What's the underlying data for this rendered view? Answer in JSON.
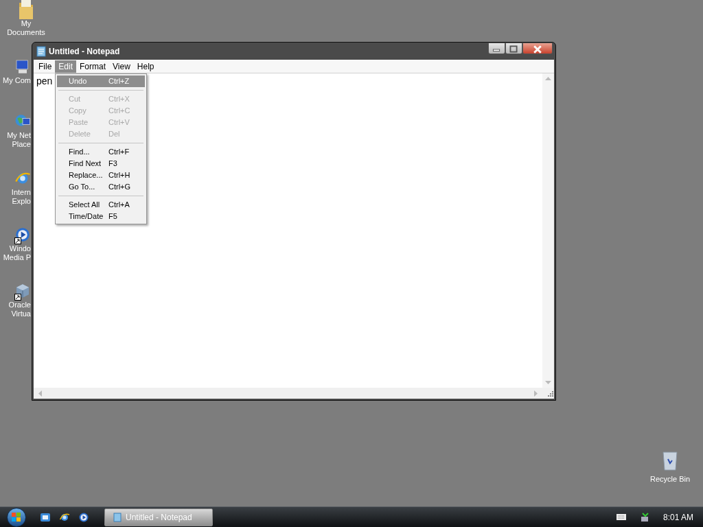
{
  "desktop_icons": [
    {
      "kind": "folder",
      "shortcut": false,
      "label_lines": [
        "My",
        "Documents"
      ]
    },
    {
      "kind": "computer",
      "shortcut": false,
      "label_lines": [
        "My Com"
      ]
    },
    {
      "kind": "network",
      "shortcut": false,
      "label_lines": [
        "My Net",
        "Place"
      ]
    },
    {
      "kind": "browser",
      "shortcut": false,
      "label_lines": [
        "Intern",
        "Explo"
      ]
    },
    {
      "kind": "media",
      "shortcut": true,
      "label_lines": [
        "Windo",
        "Media P"
      ]
    },
    {
      "kind": "cube",
      "shortcut": true,
      "label_lines": [
        "Oracle",
        "Virtua"
      ]
    }
  ],
  "window": {
    "title": "Untitled - Notepad",
    "menu": [
      {
        "label": "File",
        "selected": false
      },
      {
        "label": "Edit",
        "selected": true
      },
      {
        "label": "Format",
        "selected": false
      },
      {
        "label": "View",
        "selected": false
      },
      {
        "label": "Help",
        "selected": false
      }
    ],
    "text": "pen"
  },
  "edit_menu": {
    "groups": [
      [
        {
          "label": "Undo",
          "shortcut": "Ctrl+Z",
          "selected": true,
          "disabled": false
        }
      ],
      [
        {
          "label": "Cut",
          "shortcut": "Ctrl+X",
          "selected": false,
          "disabled": true
        },
        {
          "label": "Copy",
          "shortcut": "Ctrl+C",
          "selected": false,
          "disabled": true
        },
        {
          "label": "Paste",
          "shortcut": "Ctrl+V",
          "selected": false,
          "disabled": true
        },
        {
          "label": "Delete",
          "shortcut": "Del",
          "selected": false,
          "disabled": true
        }
      ],
      [
        {
          "label": "Find...",
          "shortcut": "Ctrl+F",
          "selected": false,
          "disabled": false
        },
        {
          "label": "Find Next",
          "shortcut": "F3",
          "selected": false,
          "disabled": false
        },
        {
          "label": "Replace...",
          "shortcut": "Ctrl+H",
          "selected": false,
          "disabled": false
        },
        {
          "label": "Go To...",
          "shortcut": "Ctrl+G",
          "selected": false,
          "disabled": false
        }
      ],
      [
        {
          "label": "Select All",
          "shortcut": "Ctrl+A",
          "selected": false,
          "disabled": false
        },
        {
          "label": "Time/Date",
          "shortcut": "F5",
          "selected": false,
          "disabled": false
        }
      ]
    ]
  },
  "recycle_bin": {
    "label": "Recycle Bin"
  },
  "taskbar": {
    "quick_launch": [
      {
        "kind": "desktop"
      },
      {
        "kind": "browser"
      },
      {
        "kind": "media"
      }
    ],
    "tasks": [
      {
        "label": "Untitled - Notepad",
        "selected": true
      }
    ],
    "clock": "8:01 AM"
  }
}
